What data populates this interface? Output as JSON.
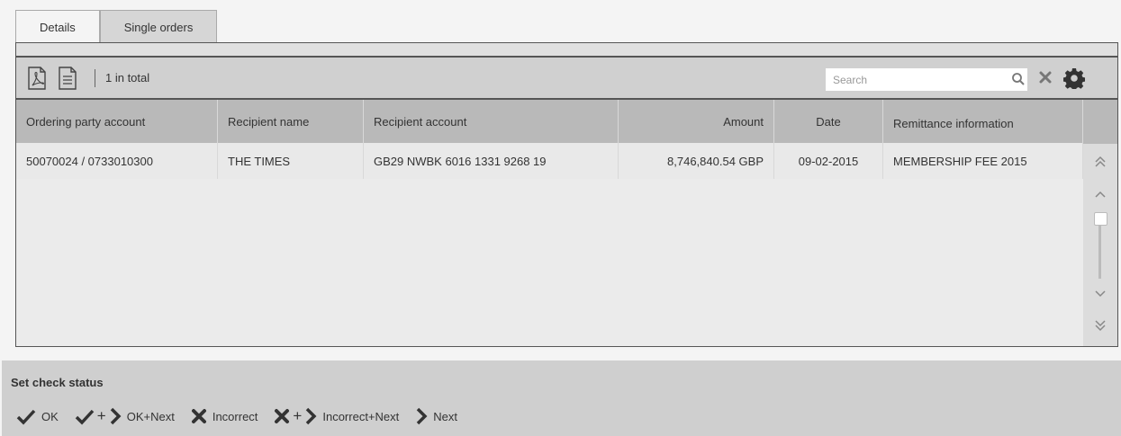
{
  "tabs": [
    {
      "label": "Details"
    },
    {
      "label": "Single orders"
    }
  ],
  "toolbar": {
    "total_text": "1 in total",
    "search_placeholder": "Search"
  },
  "table": {
    "columns": [
      "Ordering party account",
      "Recipient name",
      "Recipient account",
      "Amount",
      "Date",
      "Remittance information"
    ],
    "rows": [
      [
        "50070024 / 0733010300",
        "THE TIMES",
        "GB29 NWBK 6016 1331 9268 19",
        "8,746,840.54 GBP",
        "09-02-2015",
        "MEMBERSHIP FEE 2015"
      ]
    ]
  },
  "footer": {
    "title": "Set check status",
    "actions": {
      "ok": "OK",
      "ok_next": "OK+Next",
      "incorrect": "Incorrect",
      "incorrect_next": "Incorrect+Next",
      "next": "Next"
    },
    "plus": "+"
  },
  "icons": [
    "pdf-export-icon",
    "document-export-icon",
    "search-icon",
    "clear-icon",
    "gear-icon",
    "scroll-top-icon",
    "scroll-up-icon",
    "scroll-down-icon",
    "scroll-bottom-icon",
    "checkmark-icon",
    "cross-icon",
    "chevron-right-icon"
  ]
}
